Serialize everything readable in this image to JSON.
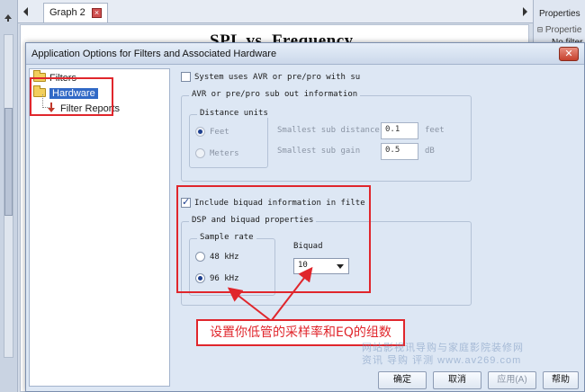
{
  "background_app": {
    "tab_label": "Graph 2",
    "graph_title": "SPL vs. Frequency",
    "properties_title": "Properties",
    "properties_row": "Propertie",
    "properties_value": "No filter"
  },
  "dialog": {
    "title": "Application Options for Filters and Associated Hardware",
    "close_glyph": "✕",
    "tree": {
      "items": [
        {
          "label": "Filters"
        },
        {
          "label": "Hardware"
        },
        {
          "label": "Filter Reports"
        }
      ]
    },
    "avr": {
      "checkbox_label": "System uses AVR or pre/pro with su",
      "group_label": "AVR or pre/pro sub out information",
      "distance_units_label": "Distance units",
      "feet_label": "Feet",
      "meters_label": "Meters",
      "smallest_distance_label": "Smallest sub distance",
      "smallest_distance_value": "0.1",
      "smallest_distance_unit": "feet",
      "smallest_gain_label": "Smallest sub gain",
      "smallest_gain_value": "0.5",
      "smallest_gain_unit": "dB"
    },
    "dsp": {
      "include_biquad_label": "Include biquad information in filte",
      "group_label": "DSP and biquad properties",
      "sample_rate_label": "Sample rate",
      "rate_48_label": "48 kHz",
      "rate_96_label": "96 kHz",
      "biquad_label": "Biquad",
      "biquad_value": "10"
    },
    "buttons": {
      "ok": "确定",
      "cancel": "取消",
      "apply": "应用(A)",
      "help": "帮助"
    }
  },
  "annotation": {
    "callout_text": "设置你低管的采样率和EQ的组数",
    "color": "#e0262c"
  },
  "watermark": {
    "line1": "网站影视讯导购与家庭影院装修网",
    "line2": "资讯 导购 评测 www.av269.com"
  }
}
